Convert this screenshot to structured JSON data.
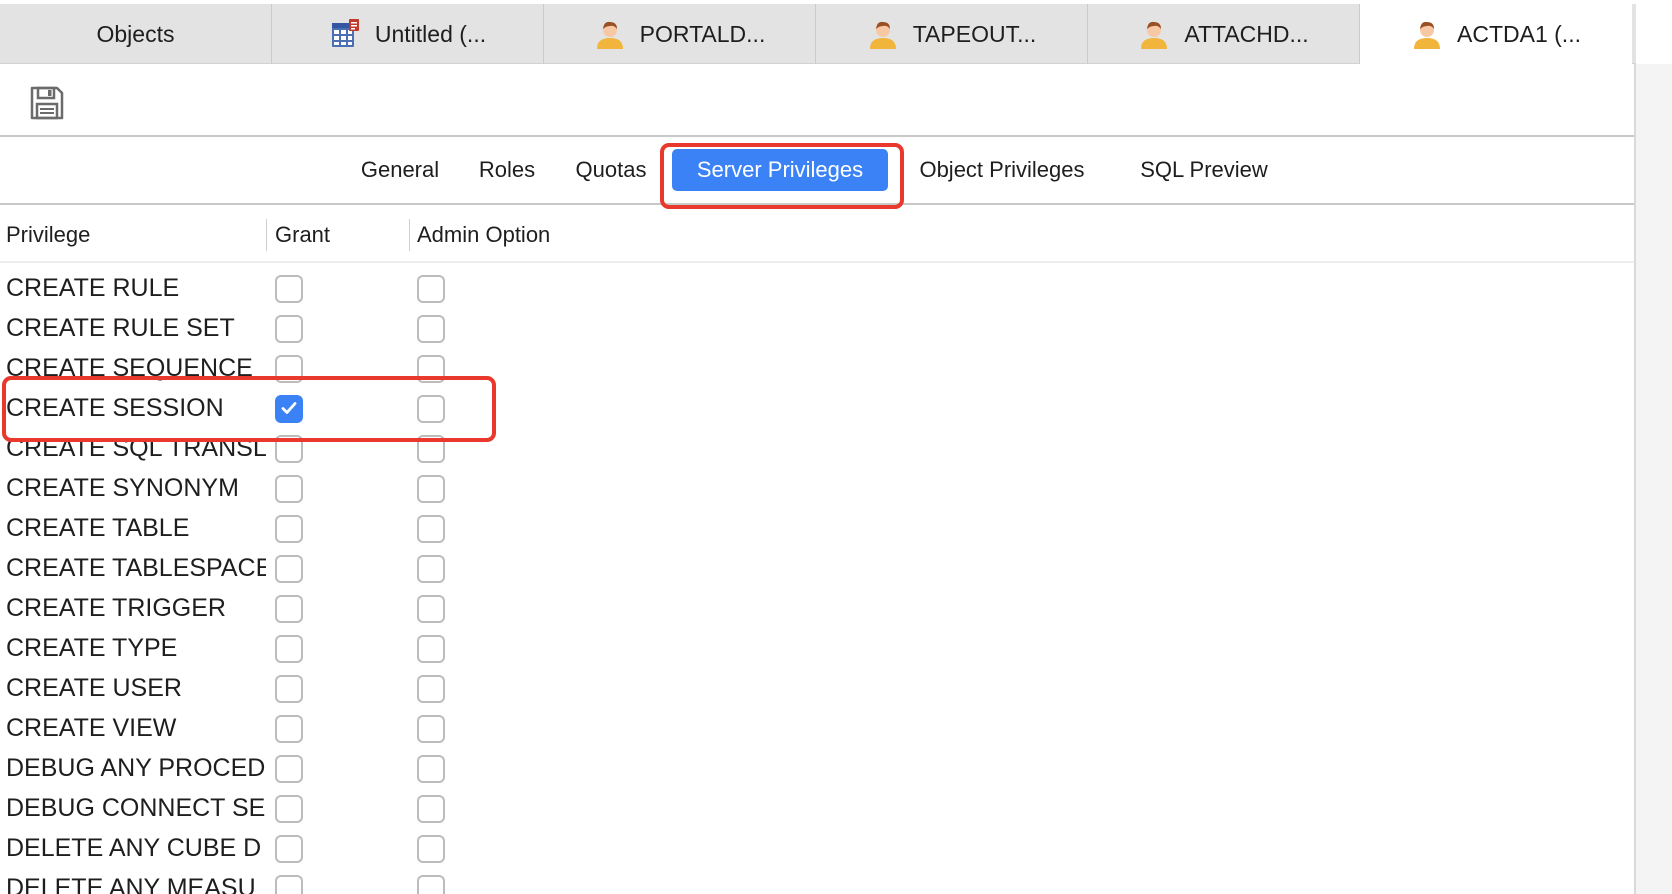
{
  "doc_tabs": [
    {
      "label": "Objects",
      "icon": "none"
    },
    {
      "label": "Untitled (...",
      "icon": "query-grid-icon"
    },
    {
      "label": "PORTALD...",
      "icon": "user-icon"
    },
    {
      "label": "TAPEOUT...",
      "icon": "user-icon"
    },
    {
      "label": "ATTACHD...",
      "icon": "user-icon"
    },
    {
      "label": "ACTDA1 (...",
      "icon": "user-icon"
    }
  ],
  "active_doc_tab": "ACTDA1 (...",
  "toolbar": {
    "save_icon": "save-icon"
  },
  "section_tabs": {
    "general": "General",
    "roles": "Roles",
    "quotas": "Quotas",
    "server_privileges": "Server Privileges",
    "object_privileges": "Object Privileges",
    "sql_preview": "SQL Preview"
  },
  "active_section_tab": "Server Privileges",
  "columns": {
    "privilege": "Privilege",
    "grant": "Grant",
    "admin_option": "Admin Option"
  },
  "privileges": [
    {
      "name": "CREATE RULE",
      "grant": false,
      "admin": false
    },
    {
      "name": "CREATE RULE SET",
      "grant": false,
      "admin": false
    },
    {
      "name": "CREATE SEQUENCE",
      "grant": false,
      "admin": false
    },
    {
      "name": "CREATE SESSION",
      "grant": true,
      "admin": false
    },
    {
      "name": "CREATE SQL TRANSL",
      "grant": false,
      "admin": false
    },
    {
      "name": "CREATE SYNONYM",
      "grant": false,
      "admin": false
    },
    {
      "name": "CREATE TABLE",
      "grant": false,
      "admin": false
    },
    {
      "name": "CREATE TABLESPACE",
      "grant": false,
      "admin": false
    },
    {
      "name": "CREATE TRIGGER",
      "grant": false,
      "admin": false
    },
    {
      "name": "CREATE TYPE",
      "grant": false,
      "admin": false
    },
    {
      "name": "CREATE USER",
      "grant": false,
      "admin": false
    },
    {
      "name": "CREATE VIEW",
      "grant": false,
      "admin": false
    },
    {
      "name": "DEBUG ANY PROCED",
      "grant": false,
      "admin": false
    },
    {
      "name": "DEBUG CONNECT SE",
      "grant": false,
      "admin": false
    },
    {
      "name": "DELETE ANY CUBE D",
      "grant": false,
      "admin": false
    },
    {
      "name": "DELETE ANY MEASU",
      "grant": false,
      "admin": false
    }
  ],
  "colors": {
    "accent": "#3a82f6",
    "highlight": "#e8392c"
  }
}
